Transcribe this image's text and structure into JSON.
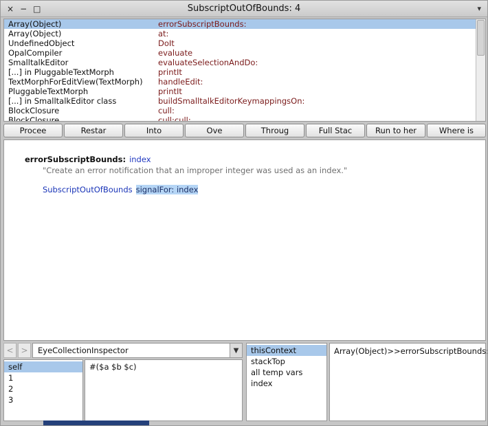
{
  "window": {
    "title": "SubscriptOutOfBounds: 4",
    "close_glyph": "×",
    "minimize_glyph": "−",
    "maximize_glyph": "□",
    "menu_glyph": "▾"
  },
  "stack_pane": {
    "rows": [
      {
        "receiver": "Array(Object)",
        "selector": "errorSubscriptBounds:",
        "selected": true
      },
      {
        "receiver": "Array(Object)",
        "selector": "at:",
        "selected": false
      },
      {
        "receiver": "UndefinedObject",
        "selector": "DoIt",
        "selected": false
      },
      {
        "receiver": "OpalCompiler",
        "selector": "evaluate",
        "selected": false
      },
      {
        "receiver": "SmalltalkEditor",
        "selector": "evaluateSelectionAndDo:",
        "selected": false
      },
      {
        "receiver": "[...] in PluggableTextMorph",
        "selector": "printIt",
        "selected": false
      },
      {
        "receiver": "TextMorphForEditView(TextMorph)",
        "selector": "handleEdit:",
        "selected": false
      },
      {
        "receiver": "PluggableTextMorph",
        "selector": "printIt",
        "selected": false
      },
      {
        "receiver": "[...] in SmalltalkEditor class",
        "selector": "buildSmalltalkEditorKeymappingsOn:",
        "selected": false
      },
      {
        "receiver": "BlockClosure",
        "selector": "cull:",
        "selected": false
      },
      {
        "receiver": "BlockClosure",
        "selector": "cull:cull:",
        "selected": false
      }
    ]
  },
  "toolbar": {
    "buttons": [
      "Procee",
      "Restar",
      "Into",
      "Ove",
      "Throug",
      "Full Stac",
      "Run to her",
      "Where is"
    ]
  },
  "source": {
    "selector": "errorSubscriptBounds:",
    "argument": "index",
    "comment": "\"Create an error notification that an improper integer was used as an index.\"",
    "receiver_class": "SubscriptOutOfBounds",
    "selected_code": "signalFor: index"
  },
  "inspector": {
    "back": "<",
    "forward": ">",
    "class_selector": "EyeCollectionInspector",
    "dropdown_glyph": "▼",
    "fields": [
      "self",
      "1",
      "2",
      "3"
    ],
    "selected_field": "self",
    "value": "#($a $b $c)"
  },
  "context_pane": {
    "items": [
      "thisContext",
      "stackTop",
      "all temp vars",
      "index"
    ],
    "selected_item": "thisContext"
  },
  "method_reference": "Array(Object)>>errorSubscriptBounds:",
  "colors": {
    "selection": "#a8c8ea",
    "code_selection": "#b5d5f5",
    "selector_text": "#7a1a1a",
    "variable_text": "#2038c0",
    "class_text": "#1a35b8",
    "comment_text": "#6f6f6f",
    "taskbar_blue": "#24407a"
  }
}
